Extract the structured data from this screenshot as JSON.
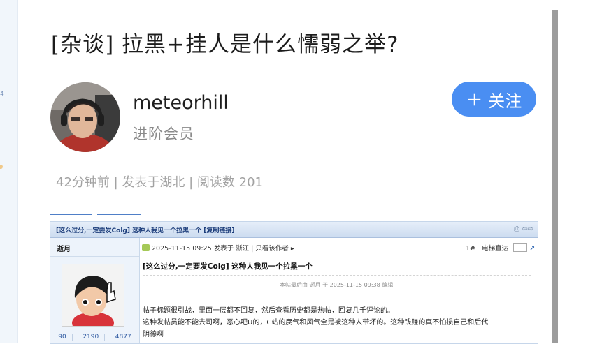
{
  "left_strip": {
    "number": "4"
  },
  "post": {
    "title": "[杂谈] 拉黑+挂人是什么懦弱之举?",
    "author": {
      "name": "meteorhill",
      "rank": "进阶会员"
    },
    "follow_label": "关注",
    "meta": "42分钟前 | 发表于湖北 | 阅读数 201"
  },
  "forum_shot": {
    "header_title": "[这么过分,一定要发Colg] 这种人我见一个拉黑一个 [复制链接]",
    "user": "逝月",
    "stats": [
      "90",
      "2190",
      "4877"
    ],
    "post_info": "2025-11-15 09:25 发表于 浙江  |  只看该作者 ▸",
    "floor": "1#",
    "floor_jump": "电梯直达",
    "title": "[这么过分,一定要发Colg] 这种人我见一个拉黑一个",
    "edit_note": "本帖最后由 逝月 于 2025-11-15 09:38 编辑",
    "body": [
      "帖子标题很引战，里面一层都不回复，然后查看历史都是热帖，回复几千评论的。",
      "这种发帖员能不能去司啊，恶心吧U的，C站的戾气和风气全是被这种人带坏的。这种钱赚的真不怕损自己和后代",
      "阴德啊"
    ]
  },
  "colors": {
    "accent": "#4a8ef2",
    "forum_header": "#ccdcf0"
  },
  "icons": [
    "plus-icon",
    "print-icon",
    "arrow-icon",
    "hand-cursor-icon",
    "post-icon",
    "go-icon"
  ]
}
